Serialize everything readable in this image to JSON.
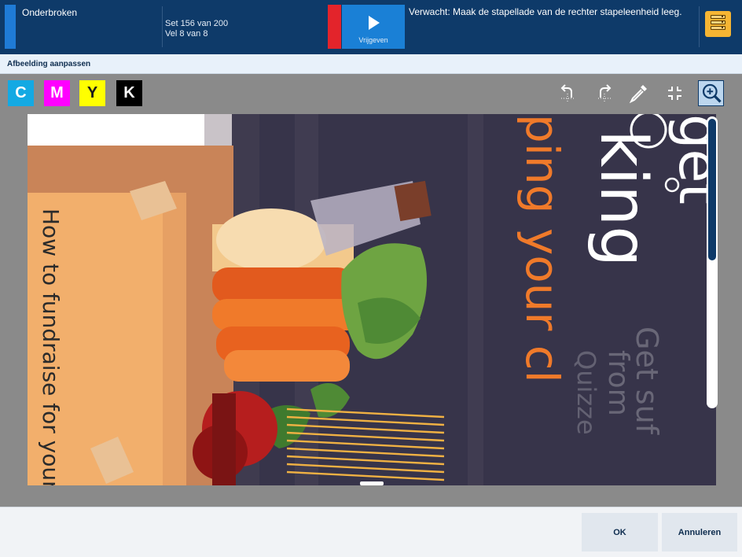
{
  "topbar": {
    "status": "Onderbroken",
    "job_set": "Set 156 van 200",
    "job_sheet": "Vel 8 van 8",
    "release_label": "Vrijgeven",
    "message": "Verwacht: Maak de stapellade van de rechter stapeleenheid leeg.",
    "stack_icon": "stacker-icon"
  },
  "subtitle": "Afbeelding aanpassen",
  "separations": [
    {
      "label": "C",
      "color": "#14a9e3"
    },
    {
      "label": "M",
      "color": "#ff00ff"
    },
    {
      "label": "Y",
      "color": "#ffff00"
    },
    {
      "label": "K",
      "color": "#000000"
    }
  ],
  "tools": [
    "rotate-left-icon",
    "rotate-right-icon",
    "eyedropper-icon",
    "fit-to-screen-icon",
    "zoom-in-icon"
  ],
  "preview": {
    "text_left": "How to fundraise for your",
    "text_orange": "ping your cl",
    "text_white": "king",
    "text_white_top": "get",
    "bg_text_1": "Get suf",
    "bg_text_2": "from",
    "bg_text_3": "Quizze"
  },
  "footer": {
    "ok": "OK",
    "cancel": "Annuleren"
  }
}
